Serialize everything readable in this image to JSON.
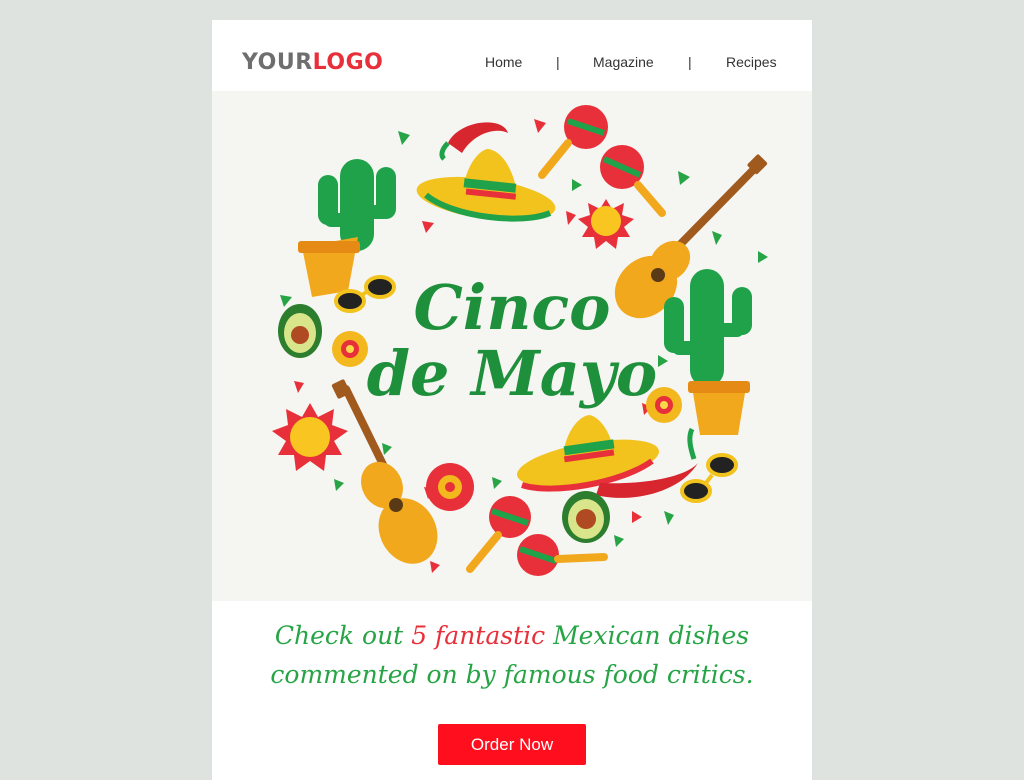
{
  "header": {
    "logo": {
      "part1": "YOUR",
      "part2": "LOGO"
    },
    "nav": [
      {
        "label": "Home"
      },
      {
        "label": "Magazine"
      },
      {
        "label": "Recipes"
      }
    ],
    "separator": "|"
  },
  "hero": {
    "title_line1": "Cinco",
    "title_line2": "de Mayo"
  },
  "headline": {
    "part1": "Check out ",
    "highlight": "5 fantastic",
    "part2": " Mexican dishes",
    "line2": "commented on by famous food critics."
  },
  "cta": {
    "label": "Order Now"
  },
  "colors": {
    "background": "#dfe3df",
    "card": "#ffffff",
    "hero_background": "#f5f5f2",
    "brand_red": "#e8303a",
    "button_red": "#ff0f1e",
    "headline_green": "#27a445"
  }
}
